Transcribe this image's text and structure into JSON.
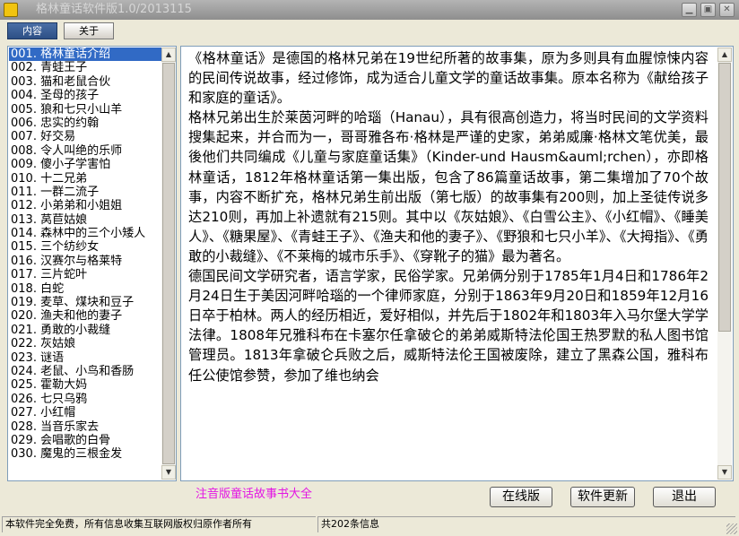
{
  "window": {
    "title": "格林童话软件版1.0/2013115"
  },
  "tabs": [
    {
      "label": "内容",
      "active": true
    },
    {
      "label": "关于",
      "active": false
    }
  ],
  "list": {
    "items": [
      "001. 格林童话介绍",
      "002. 青蛙王子",
      "003. 猫和老鼠合伙",
      "004. 圣母的孩子",
      "005. 狼和七只小山羊",
      "006. 忠实的约翰",
      "007. 好交易",
      "008. 令人叫绝的乐师",
      "009. 傻小子学害怕",
      "010. 十二兄弟",
      "011. 一群二流子",
      "012. 小弟弟和小姐姐",
      "013. 莴苣姑娘",
      "014. 森林中的三个小矮人",
      "015. 三个纺纱女",
      "016. 汉赛尔与格莱特",
      "017. 三片蛇叶",
      "018. 白蛇",
      "019. 麦草、煤块和豆子",
      "020. 渔夫和他的妻子",
      "021. 勇敢的小裁缝",
      "022. 灰姑娘",
      "023. 谜语",
      "024. 老鼠、小鸟和香肠",
      "025. 霍勒大妈",
      "026. 七只乌鸦",
      "027. 小红帽",
      "028. 当音乐家去",
      "029. 会唱歌的白骨",
      "030. 魔鬼的三根金发"
    ],
    "selected_index": 0
  },
  "content": {
    "paragraphs": [
      "《格林童话》是德国的格林兄弟在19世纪所著的故事集，原为多则具有血腥惊悚内容的民间传说故事，经过修饰，成为适合儿童文学的童话故事集。原本名称为《献给孩子和家庭的童话》。",
      "格林兄弟出生於莱茵河畔的哈瑙（Hanau），具有很高创造力，将当时民间的文学资料搜集起来，并合而为一，哥哥雅各布·格林是严谨的史家，弟弟威廉·格林文笔优美，最後他们共同编成《儿童与家庭童话集》（Kinder-und Hausm&auml;rchen），亦即格林童话，1812年格林童话第一集出版，包含了86篇童话故事，第二集增加了70个故事，内容不断扩充，格林兄弟生前出版（第七版）的故事集有200则，加上圣徒传说多达210则，再加上补遗就有215则。其中以《灰姑娘》、《白雪公主》、《小红帽》、《睡美人》、《糖果屋》、《青蛙王子》、《渔夫和他的妻子》、《野狼和七只小羊》、《大拇指》、《勇敢的小裁缝》、《不莱梅的城市乐手》、《穿靴子的猫》最为著名。",
      "德国民间文学研究者，语言学家，民俗学家。兄弟俩分别于1785年1月4日和1786年2月24日生于美因河畔哈瑙的一个律师家庭，分别于1863年9月20日和1859年12月16日卒于柏林。两人的经历相近，爱好相似，并先后于1802年和1803年入马尔堡大学学法律。1808年兄雅科布在卡塞尔任拿破仑的弟弟威斯特法伦国王热罗默的私人图书馆管理员。1813年拿破仑兵败之后，威斯特法伦王国被废除，建立了黑森公国，雅科布任公使馆参赞，参加了维也纳会"
    ]
  },
  "footer": {
    "title": "注音版童话故事书大全",
    "buttons": {
      "online": "在线版",
      "update": "软件更新",
      "exit": "退出"
    }
  },
  "status": {
    "left": "本软件完全免费，所有信息收集互联网版权归原作者所有",
    "count": "共202条信息"
  },
  "colors": {
    "selection": "#316ac5",
    "footer_title": "#e316e3",
    "tab_active": "#2d4f85"
  }
}
